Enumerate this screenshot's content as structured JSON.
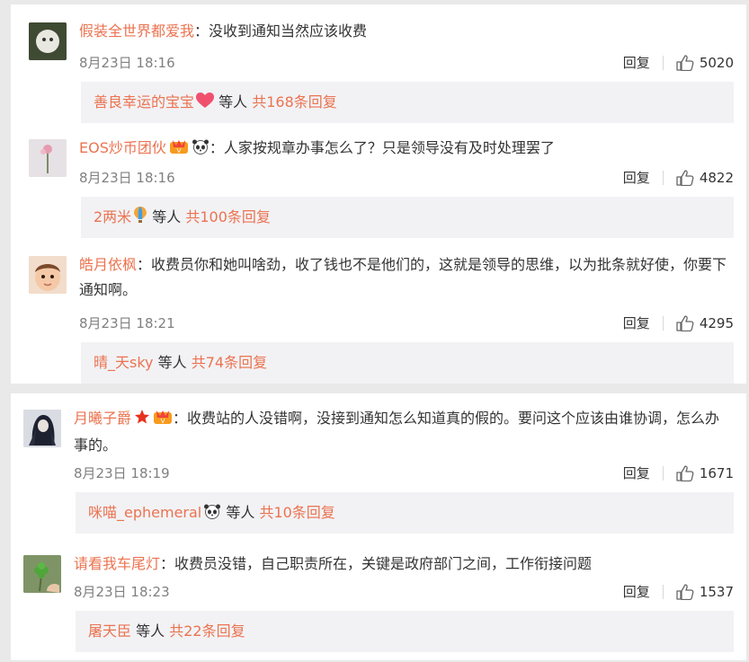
{
  "comments": [
    {
      "username": "假装全世界都爱我",
      "text": "：没收到通知当然应该收费",
      "time": "8月23日 18:16",
      "reply_label": "回复",
      "likes": "5020",
      "reply_summary": {
        "user": "善良幸运的宝宝",
        "mid": " 等人 ",
        "count": "共168条回复"
      }
    },
    {
      "username": "EOS炒币团伙",
      "text": "：人家按规章办事怎么了？只是领导没有及时处理罢了",
      "time": "8月23日 18:16",
      "reply_label": "回复",
      "likes": "4822",
      "reply_summary": {
        "user": "2两米",
        "mid": " 等人 ",
        "count": "共100条回复"
      }
    },
    {
      "username": "皓月依枫",
      "text": "：收费员你和她叫啥劲，收了钱也不是他们的，这就是领导的思维，以为批条就好使，你要下通知啊。",
      "time": "8月23日 18:21",
      "reply_label": "回复",
      "likes": "4295",
      "reply_summary": {
        "user": "晴_天sky",
        "mid": " 等人 ",
        "count": "共74条回复"
      }
    },
    {
      "username": "月曦子爵",
      "text": "：收费站的人没错啊，没接到通知怎么知道真的假的。要问这个应该由谁协调，怎么办事的。",
      "time": "8月23日 18:19",
      "reply_label": "回复",
      "likes": "1671",
      "reply_summary": {
        "user": "咪喵_ephemeral",
        "mid": " 等人 ",
        "count": "共10条回复"
      }
    },
    {
      "username": "请看我车尾灯",
      "text": "：收费员没错，自己职责所在，关键是政府部门之间，工作衔接问题",
      "time": "8月23日 18:23",
      "reply_label": "回复",
      "likes": "1537",
      "reply_summary": {
        "user": "屠天臣",
        "mid": " 等人 ",
        "count": "共22条回复"
      }
    }
  ],
  "colors": {
    "username": "#eb7350",
    "reply_bg": "#f2f2f5",
    "meta": "#808080"
  }
}
